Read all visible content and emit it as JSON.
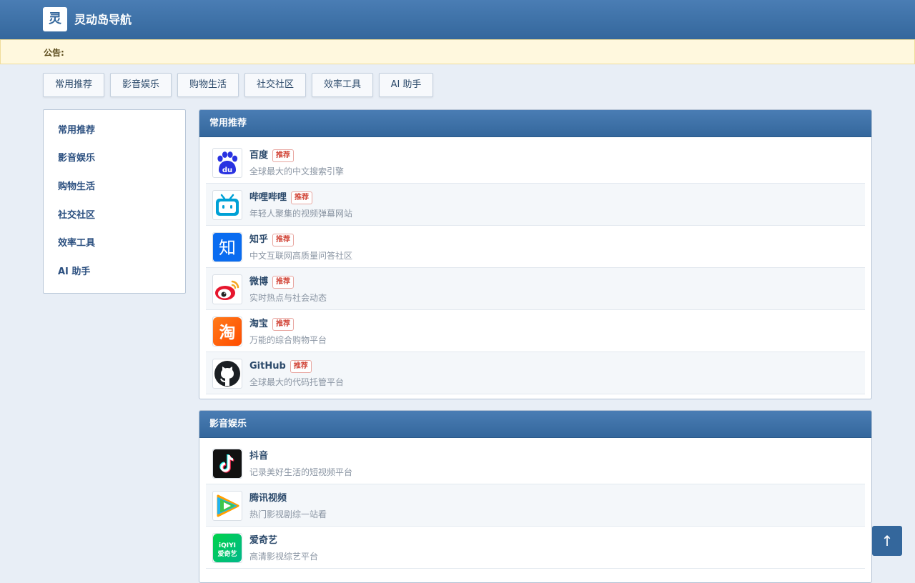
{
  "header": {
    "logo_char": "灵",
    "title": "灵动岛导航"
  },
  "notice": {
    "label": "公告:"
  },
  "tabs": [
    "常用推荐",
    "影音娱乐",
    "购物生活",
    "社交社区",
    "效率工具",
    "AI 助手"
  ],
  "sidebar": [
    "常用推荐",
    "影音娱乐",
    "购物生活",
    "社交社区",
    "效率工具",
    "AI 助手"
  ],
  "sections": [
    {
      "title": "常用推荐",
      "badge": "推荐",
      "items": [
        {
          "name": "百度",
          "desc": "全球最大的中文搜索引擎",
          "icon": "baidu-icon"
        },
        {
          "name": "哔哩哔哩",
          "desc": "年轻人聚集的视频弹幕网站",
          "icon": "bilibili-icon"
        },
        {
          "name": "知乎",
          "desc": "中文互联网高质量问答社区",
          "icon": "zhihu-icon",
          "icon_text": "知"
        },
        {
          "name": "微博",
          "desc": "实时热点与社会动态",
          "icon": "weibo-icon"
        },
        {
          "name": "淘宝",
          "desc": "万能的综合购物平台",
          "icon": "taobao-icon",
          "icon_text": "淘"
        },
        {
          "name": "GitHub",
          "desc": "全球最大的代码托管平台",
          "icon": "github-icon"
        }
      ]
    },
    {
      "title": "影音娱乐",
      "items": [
        {
          "name": "抖音",
          "desc": "记录美好生活的短视频平台",
          "icon": "douyin-icon"
        },
        {
          "name": "腾讯视频",
          "desc": "热门影视剧综一站看",
          "icon": "tencent-video-icon"
        },
        {
          "name": "爱奇艺",
          "desc": "高清影视综艺平台",
          "icon": "iqiyi-icon",
          "icon_text": [
            "iQIYI",
            "爱奇艺"
          ]
        }
      ]
    }
  ],
  "back_to_top": "↑",
  "colors": {
    "header": "#34679c",
    "badge": "#d2473a",
    "notice_bg": "#fff8de"
  }
}
